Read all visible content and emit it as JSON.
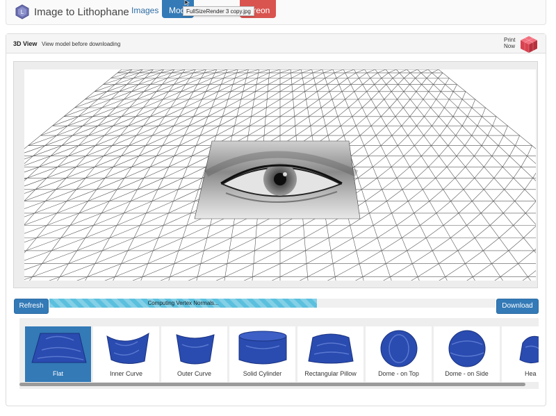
{
  "header": {
    "brand": "Image to Lithophane",
    "nav_images": "Images",
    "nav_model": "Mode",
    "nav_patreon": "treon",
    "tooltip": "FullSizeRender 3 copy.jpg"
  },
  "panel": {
    "title": "3D View",
    "subtitle": "View model before downloading",
    "print_now_line1": "Print",
    "print_now_line2": "Now"
  },
  "controls": {
    "refresh_label": "Refresh",
    "download_label": "Download",
    "progress_text": "Computing Vertex Normals...",
    "progress_fraction": 0.6
  },
  "shapes": [
    {
      "label": "Flat",
      "icon": "flat-plate-icon",
      "active": true
    },
    {
      "label": "Inner Curve",
      "icon": "inner-curve-icon",
      "active": false
    },
    {
      "label": "Outer Curve",
      "icon": "outer-curve-icon",
      "active": false
    },
    {
      "label": "Solid Cylinder",
      "icon": "solid-cylinder-icon",
      "active": false
    },
    {
      "label": "Rectangular Pillow",
      "icon": "rectangular-pillow-icon",
      "active": false
    },
    {
      "label": "Dome - on Top",
      "icon": "dome-top-icon",
      "active": false
    },
    {
      "label": "Dome - on Side",
      "icon": "dome-side-icon",
      "active": false
    },
    {
      "label": "Hea",
      "icon": "heart-icon",
      "active": false
    }
  ],
  "colors": {
    "primary": "#337ab7",
    "danger": "#d9534f",
    "progress": "#5bc0de",
    "model_blue": "#2a4bb0"
  }
}
